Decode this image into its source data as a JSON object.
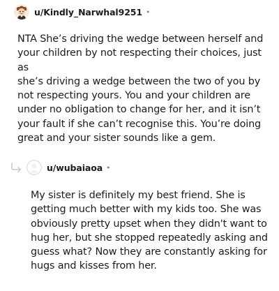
{
  "comments": [
    {
      "username": "u/Kindly_Narwhal9251",
      "separator": "•",
      "body": "NTA She’s driving the wedge between herself and\nyour children by not respecting their choices, just as\nshe’s driving a wedge between the two of you by\nnot respecting yours. You and your children are\nunder no obligation to change for her, and it isn’t\nyour fault if she can’t recognise this. You’re doing\ngreat and your sister sounds like a gem."
    },
    {
      "username": "u/wubaiaoa",
      "separator": "•",
      "body": "My sister is definitely my best friend. She is\ngetting much better with my kids too. She was\nobviously pretty upset when they didn't want to\nhug her, but she stopped repeatedly asking and\nguess what? Now they are constantly asking for\nhugs and kisses from her."
    }
  ],
  "icons": {
    "first_avatar": "cartoon-avatar-icon",
    "second_avatar": "default-avatar-icon",
    "reply": "reply-arrow-icon"
  },
  "colors": {
    "text": "#1c1c1c",
    "meta": "#878a8c",
    "avatar_bg": "#edeff1",
    "reply_line": "#c8cbcd"
  }
}
